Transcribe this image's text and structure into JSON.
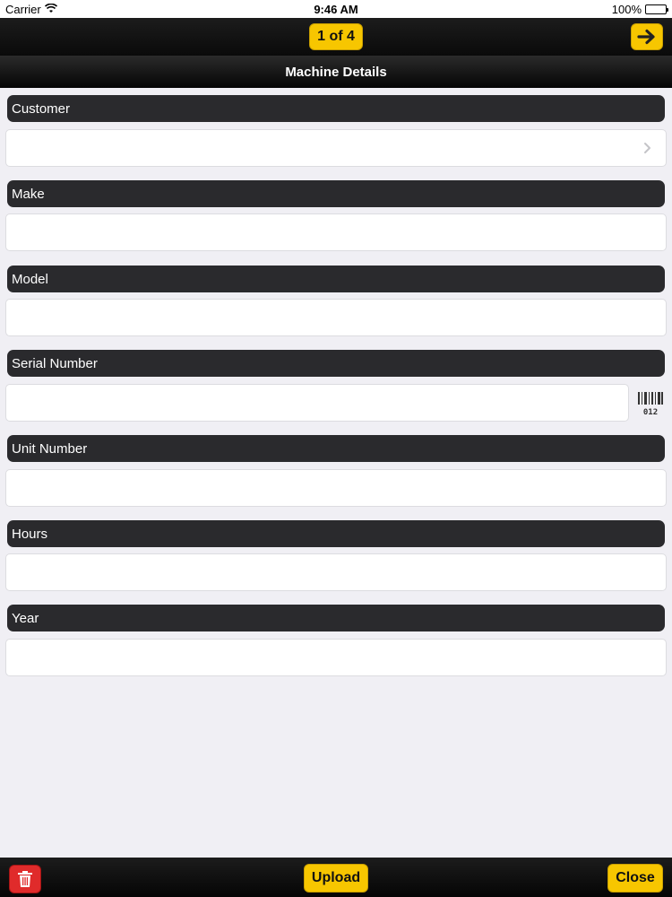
{
  "status_bar": {
    "carrier": "Carrier",
    "time": "9:46 AM",
    "battery": "100%",
    "battery_level": 1.0,
    "wifi_icon": "wifi-icon"
  },
  "top_bar": {
    "page_indicator": "1 of 4",
    "next_icon": "arrow-right-icon"
  },
  "title": "Machine Details",
  "fields": [
    {
      "label": "Customer",
      "value": "",
      "accessory": "chevron-right-icon"
    },
    {
      "label": "Make",
      "value": ""
    },
    {
      "label": "Model",
      "value": ""
    },
    {
      "label": "Serial Number",
      "value": "",
      "accessory": "barcode-icon",
      "barcode_text": "012"
    },
    {
      "label": "Unit Number",
      "value": ""
    },
    {
      "label": "Hours",
      "value": ""
    },
    {
      "label": "Year",
      "value": ""
    }
  ],
  "bottom_bar": {
    "delete_icon": "trash-icon",
    "upload_label": "Upload",
    "close_label": "Close"
  },
  "colors": {
    "accent": "#f7c600",
    "danger": "#e02b2b",
    "bar_dark": "#0a0a0a",
    "label_bg": "#2a2a2d",
    "page_bg": "#f0eff4"
  }
}
